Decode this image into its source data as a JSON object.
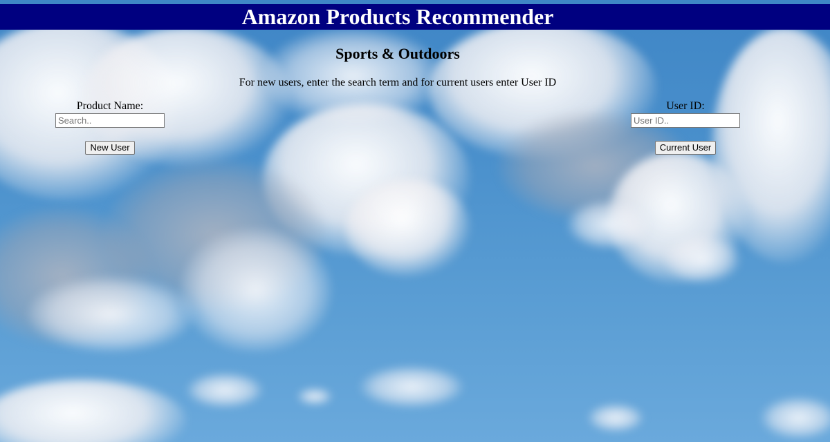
{
  "header": {
    "title": "Amazon Products Recommender",
    "bar_color": "#000080",
    "title_color": "#ffffff"
  },
  "main": {
    "category": "Sports & Outdoors",
    "instructions": "For new users, enter the search term and for current users enter User ID"
  },
  "new_user_form": {
    "label": "Product Name:",
    "placeholder": "Search..",
    "value": "",
    "button_label": "New User"
  },
  "current_user_form": {
    "label": "User ID:",
    "placeholder": "User ID..",
    "value": "",
    "button_label": "Current User"
  },
  "background": {
    "description_icon": "sky-clouds-background",
    "sky_color": "#4a90cc"
  }
}
